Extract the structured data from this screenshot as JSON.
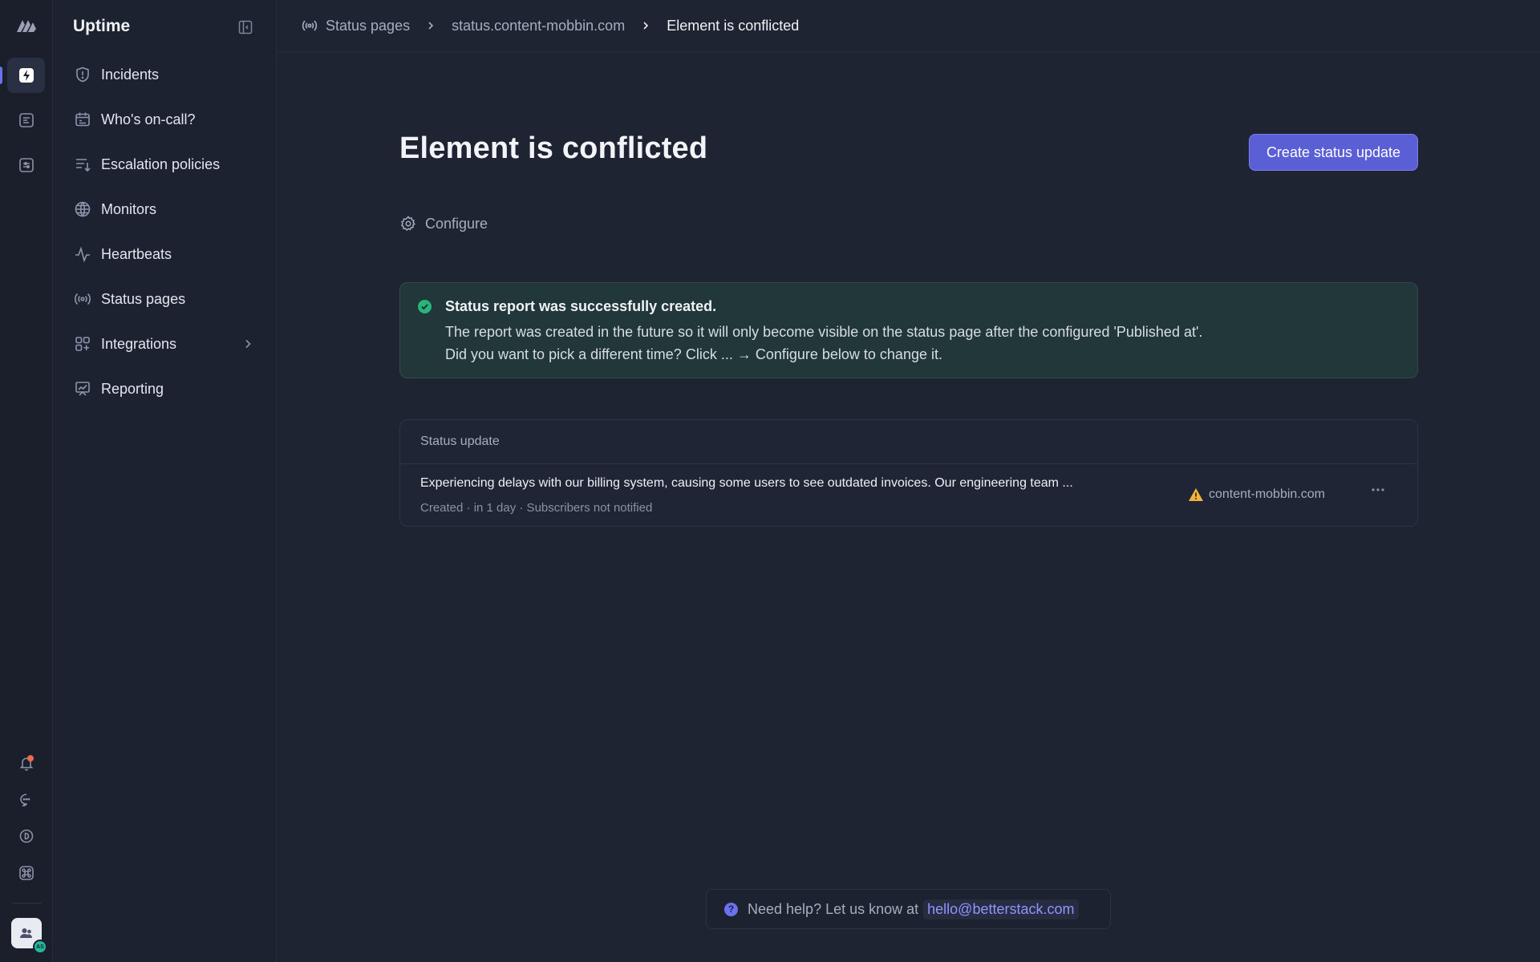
{
  "app": {
    "name": "Uptime"
  },
  "sidebar": {
    "items": [
      {
        "label": "Incidents",
        "icon": "shield-alert-icon"
      },
      {
        "label": "Who's on-call?",
        "icon": "calendar-icon"
      },
      {
        "label": "Escalation policies",
        "icon": "escalation-list-icon"
      },
      {
        "label": "Monitors",
        "icon": "globe-icon"
      },
      {
        "label": "Heartbeats",
        "icon": "pulse-icon"
      },
      {
        "label": "Status pages",
        "icon": "broadcast-icon"
      },
      {
        "label": "Integrations",
        "icon": "grid-plus-icon"
      },
      {
        "label": "Reporting",
        "icon": "chart-board-icon"
      }
    ]
  },
  "breadcrumb": {
    "items": [
      "Status pages",
      "status.content-mobbin.com",
      "Element is conflicted"
    ]
  },
  "page": {
    "title": "Element is conflicted",
    "primary_button": "Create status update",
    "configure_label": "Configure"
  },
  "alert": {
    "title": "Status report was successfully created.",
    "line1": "The report was created in the future so it will only become visible on the status page after the configured 'Published at'.",
    "line2": "Did you want to pick a different time? Click ... → Configure below to change it."
  },
  "updates": {
    "header": "Status update",
    "rows": [
      {
        "message": "Experiencing delays with our billing system, causing some users to see outdated invoices. Our engineering team ...",
        "meta": "Created · in 1 day · Subscribers not notified",
        "page": "content-mobbin.com"
      }
    ]
  },
  "help": {
    "text": "Need help? Let us know at",
    "email": "hello@betterstack.com"
  },
  "user": {
    "initials": "AS"
  },
  "colors": {
    "accent": "#5b5fd6",
    "success": "#2bb37c",
    "warning": "#f2b33d",
    "notification": "#f06a4d"
  }
}
